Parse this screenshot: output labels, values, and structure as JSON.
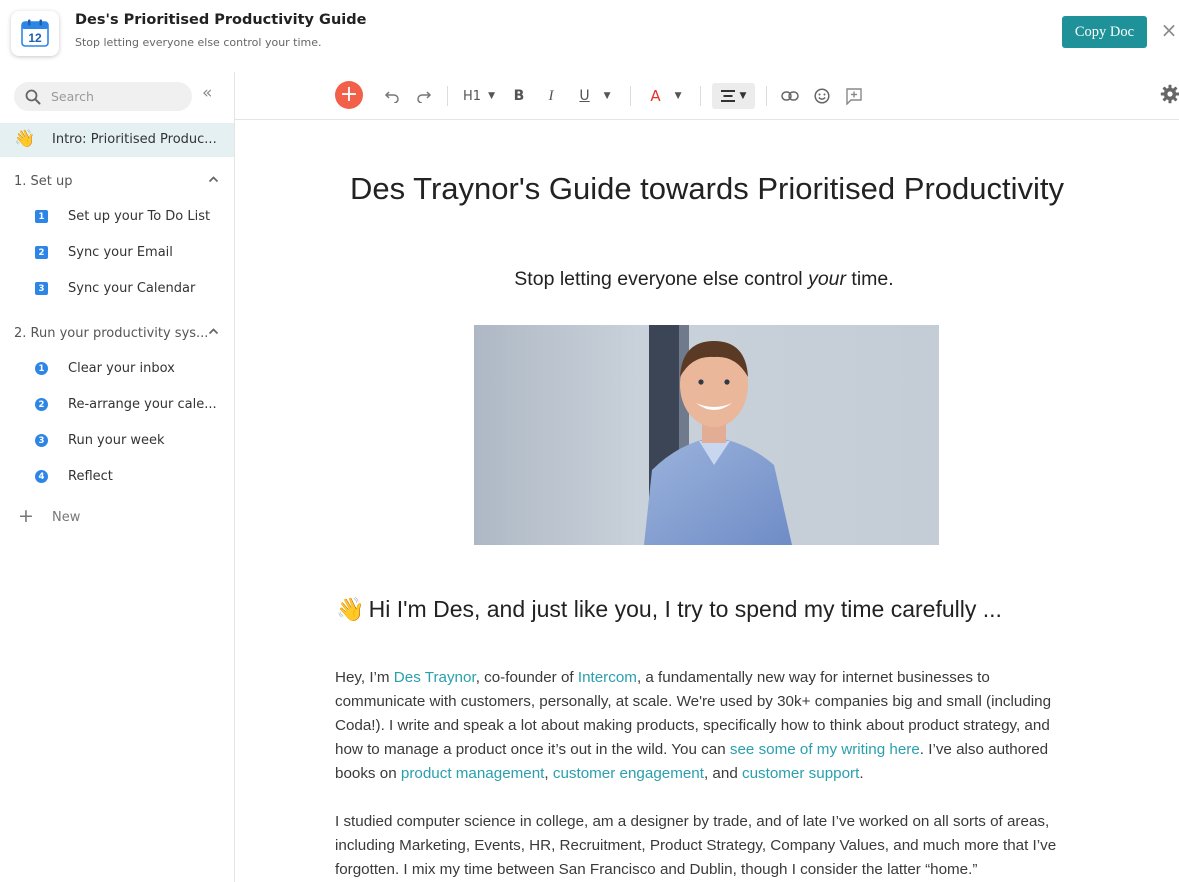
{
  "header": {
    "icon_day": "12",
    "title": "Des's Prioritised Productivity Guide",
    "subtitle": "Stop letting everyone else control your time.",
    "copy_button": "Copy Doc",
    "close_label": "×"
  },
  "sidebar": {
    "search_placeholder": "Search",
    "collapse_label": "«",
    "active_item": {
      "emoji": "👋",
      "label": "Intro: Prioritised Produc..."
    },
    "sections": [
      {
        "label": "1. Set up",
        "items": [
          {
            "num": "1",
            "label": "Set up your To Do List"
          },
          {
            "num": "2",
            "label": "Sync your Email"
          },
          {
            "num": "3",
            "label": "Sync your Calendar"
          }
        ]
      },
      {
        "label": "2. Run your productivity sys...",
        "items": [
          {
            "num": "1",
            "label": "Clear your inbox"
          },
          {
            "num": "2",
            "label": "Re-arrange your cale..."
          },
          {
            "num": "3",
            "label": "Run your week"
          },
          {
            "num": "4",
            "label": "Reflect"
          }
        ]
      }
    ],
    "new_label": "New"
  },
  "toolbar": {
    "heading_label": "H1",
    "bold_label": "B",
    "italic_label": "I",
    "underline_label": "U",
    "color_label": "A",
    "colors": {
      "accent": "#1f9299",
      "add": "#f2604a",
      "text_color": "#e2332b",
      "link": "#2aa0ae",
      "badge": "#2d86e6"
    }
  },
  "document": {
    "title": "Des Traynor's Guide towards Prioritised Productivity",
    "subtitle_pre": "Stop letting everyone else control ",
    "subtitle_em": "your",
    "subtitle_post": " time.",
    "section_emoji": "👋",
    "section_heading": "Hi I'm Des, and just like you, I try to spend my time carefully ...",
    "p1": {
      "t1": "Hey, I’m ",
      "link1": "Des Traynor",
      "t2": ", co-founder of ",
      "link2": "Intercom",
      "t3": ", a fundamentally new way for internet businesses to communicate with customers, personally, at scale. We're used by 30k+ companies big and small (including Coda!). I write and speak a lot about making products, specifically how to think about product strategy, and how to manage a product once it’s out in the wild. You can ",
      "link3": "see some of my writing here",
      "t4": ". I’ve also authored books on ",
      "link4": "product management",
      "t5": ", ",
      "link5": "customer engagement",
      "t6": ", and ",
      "link6": "customer support",
      "t7": "."
    },
    "p2": "I studied computer science in college, am a designer by trade, and of late I’ve worked on all sorts of areas, including Marketing, Events, HR, Recruitment, Product Strategy, Company Values, and much more that I’ve forgotten. I mix my time between San Francisco and Dublin, though I consider the latter “home.”"
  }
}
